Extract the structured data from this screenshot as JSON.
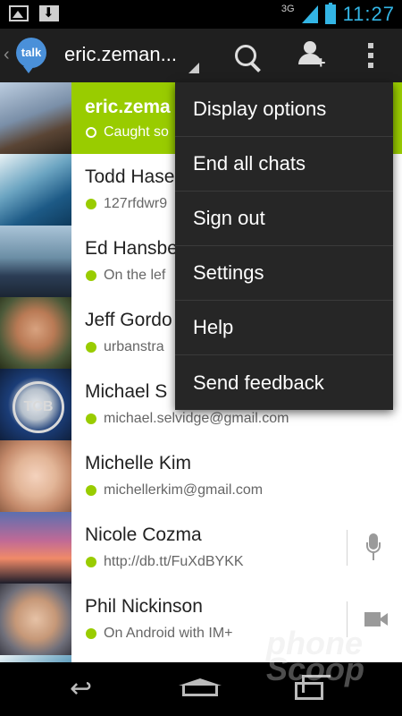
{
  "status_bar": {
    "network": "3G",
    "time": "11:27"
  },
  "action_bar": {
    "app_logo": "talk",
    "account": "eric.zeman..."
  },
  "contacts": [
    {
      "name": "eric.zema",
      "status": "Caught so",
      "presence": "idle-ring",
      "is_self": true
    },
    {
      "name": "Todd Hase",
      "status": "127rfdwr9",
      "presence": "online"
    },
    {
      "name": "Ed Hansbe",
      "status": "On the lef",
      "presence": "online"
    },
    {
      "name": "Jeff Gordo",
      "status": "urbanstra",
      "presence": "online"
    },
    {
      "name": "Michael S",
      "status": "michael.selvidge@gmail.com",
      "presence": "online",
      "avatar_label": "TCB"
    },
    {
      "name": "Michelle Kim",
      "status": "michellerkim@gmail.com",
      "presence": "online"
    },
    {
      "name": "Nicole Cozma",
      "status": "http://db.tt/FuXdBYKK",
      "presence": "online",
      "action_icon": "mic-icon"
    },
    {
      "name": "Phil Nickinson",
      "status": "On Android with IM+",
      "presence": "online",
      "action_icon": "video-camera-icon"
    }
  ],
  "overflow_menu": {
    "items": [
      "Display options",
      "End all chats",
      "Sign out",
      "Settings",
      "Help",
      "Send feedback"
    ]
  },
  "watermark": {
    "line1": "phone",
    "line2": "Scoop"
  }
}
